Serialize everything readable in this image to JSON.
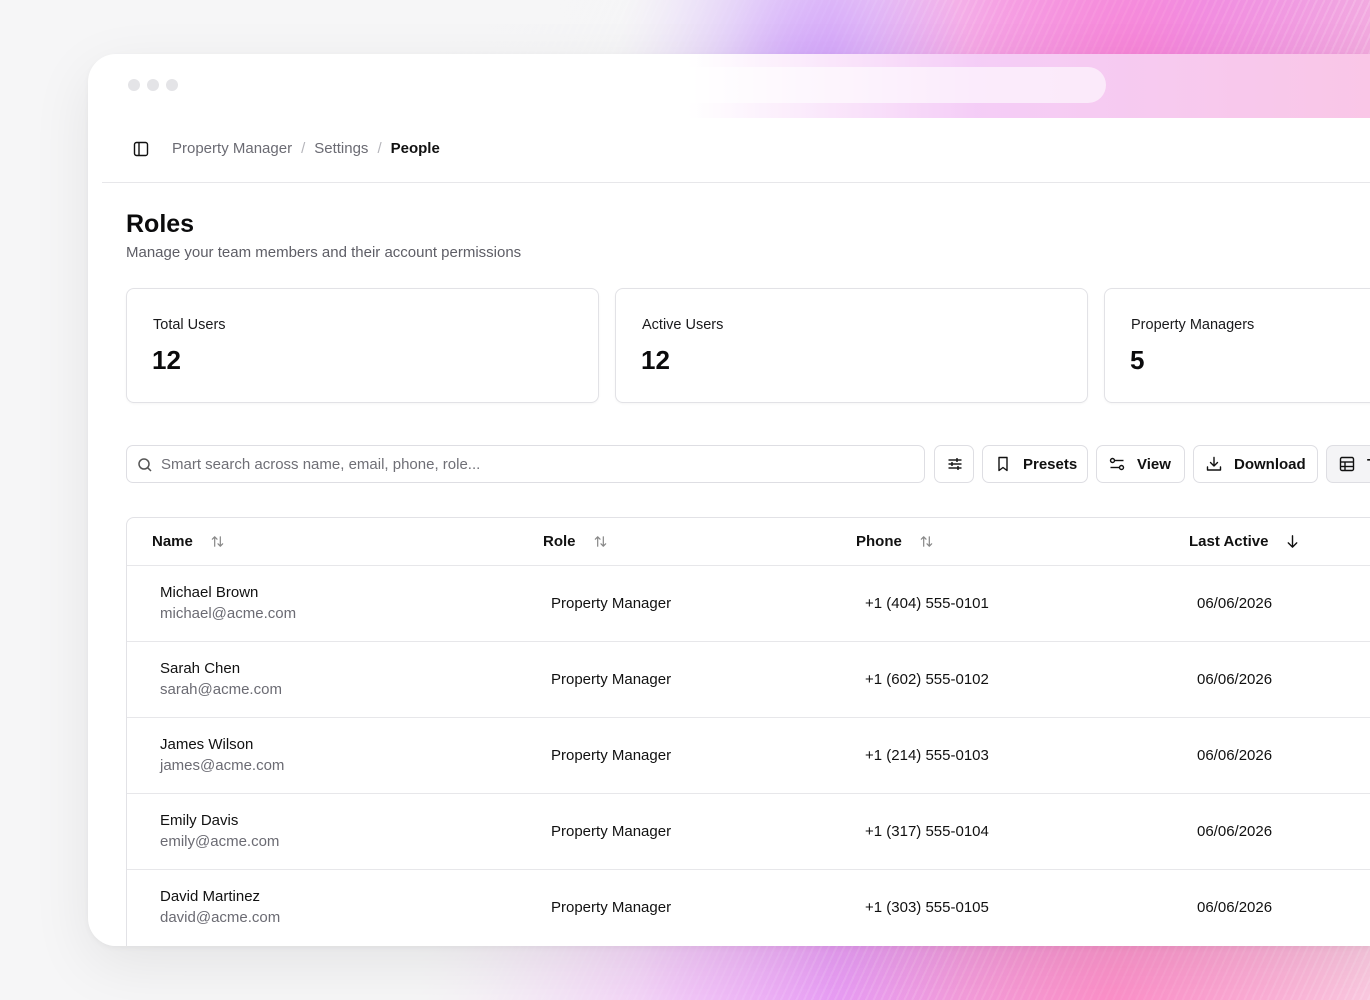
{
  "breadcrumb": {
    "items": [
      "Property Manager",
      "Settings"
    ],
    "separator": "/",
    "current": "People"
  },
  "page": {
    "title": "Roles",
    "subtitle": "Manage your team members and their account permissions"
  },
  "stats": [
    {
      "label": "Total Users",
      "value": "12"
    },
    {
      "label": "Active Users",
      "value": "12"
    },
    {
      "label": "Property Managers",
      "value": "5"
    }
  ],
  "toolbar": {
    "search_placeholder": "Smart search across name, email, phone, role...",
    "filter_icon": "sliders-icon",
    "presets_label": "Presets",
    "view_label": "View",
    "download_label": "Download",
    "table_label": "Ta"
  },
  "table": {
    "columns": [
      "Name",
      "Role",
      "Phone",
      "Last Active"
    ],
    "rows": [
      {
        "name": "Michael Brown",
        "email": "michael@acme.com",
        "role": "Property Manager",
        "phone": "+1 (404) 555-0101",
        "last_active": "06/06/2026"
      },
      {
        "name": "Sarah Chen",
        "email": "sarah@acme.com",
        "role": "Property Manager",
        "phone": "+1 (602) 555-0102",
        "last_active": "06/06/2026"
      },
      {
        "name": "James Wilson",
        "email": "james@acme.com",
        "role": "Property Manager",
        "phone": "+1 (214) 555-0103",
        "last_active": "06/06/2026"
      },
      {
        "name": "Emily Davis",
        "email": "emily@acme.com",
        "role": "Property Manager",
        "phone": "+1 (317) 555-0104",
        "last_active": "06/06/2026"
      },
      {
        "name": "David Martinez",
        "email": "david@acme.com",
        "role": "Property Manager",
        "phone": "+1 (303) 555-0105",
        "last_active": "06/06/2026"
      }
    ]
  },
  "colors": {
    "text": "#111111",
    "muted": "#6b6b73",
    "border": "#e2e2e6",
    "gradient_pink": "#f7b2d8",
    "gradient_purple": "#e6a4f2"
  }
}
